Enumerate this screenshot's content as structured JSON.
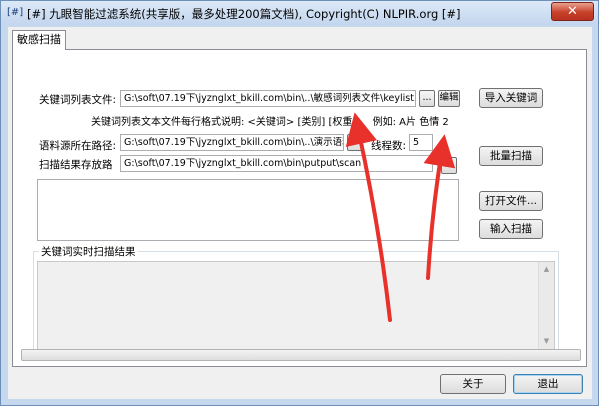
{
  "window": {
    "title": "[#] 九眼智能过滤系统(共享版，最多处理200篇文档), Copyright(C) NLPIR.org [#]",
    "title_icon": "[#]",
    "close_glyph": "✕"
  },
  "tab": {
    "label": "敏感扫描"
  },
  "keywords": {
    "label": "关键词列表文件:",
    "path": "G:\\soft\\07.19下\\jyznglxt_bkill.com\\bin\\..\\敏感词列表文件\\keylist.txt",
    "browse": "...",
    "edit_button": "编辑",
    "import_button": "导入关键词",
    "help": "关键词列表文本文件每行格式说明: <关键词> [类别] [权重] 。 例如: A片 色情 2"
  },
  "corpus": {
    "label": "语料源所在路径:",
    "path": "G:\\soft\\07.19下\\jyznglxt_bkill.com\\bin\\..\\演示语料",
    "browse": "...",
    "threads_label": "线程数:",
    "threads_value": "5"
  },
  "output": {
    "label": "扫描结果存放路",
    "path": "G:\\soft\\07.19下\\jyznglxt_bkill.com\\bin\\putput\\scan",
    "browse": "..."
  },
  "buttons": {
    "batch_scan": "批量扫描",
    "open_file": "打开文件...",
    "input_scan": "输入扫描",
    "about": "关于",
    "exit": "退出"
  },
  "results": {
    "title": "关键词实时扫描结果"
  },
  "scroll": {
    "up": "▲",
    "down": "▼"
  },
  "progress": {
    "value": 0
  },
  "colors": {
    "annotation_arrow": "#e8312a",
    "titlebar": "#c3d6ee",
    "close": "#c7402a"
  }
}
